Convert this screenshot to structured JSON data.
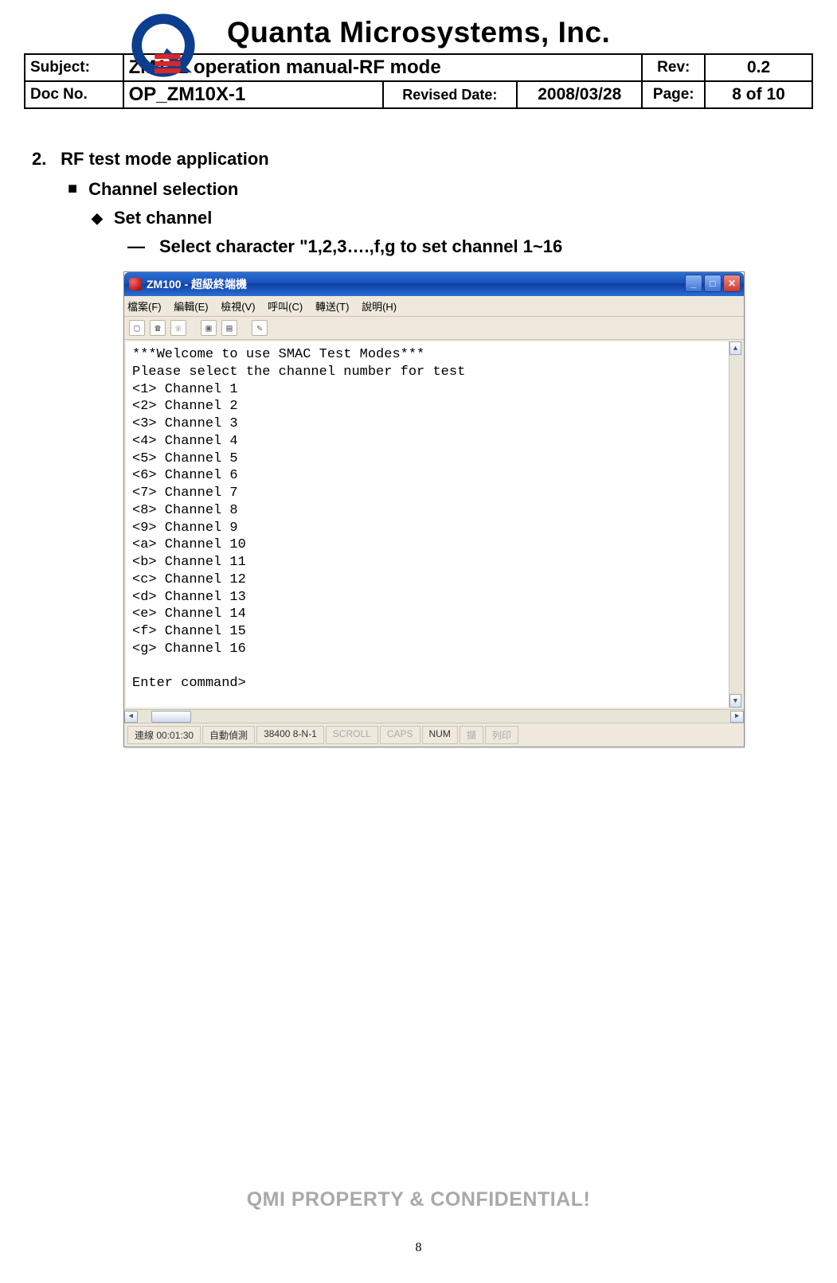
{
  "header": {
    "company": "Quanta Microsystems, Inc.",
    "row1": {
      "subject_label": "Subject:",
      "subject_value": "ZM101 operation manual-RF mode",
      "rev_label": "Rev:",
      "rev_value": "0.2"
    },
    "row2": {
      "docno_label": "Doc No.",
      "docno_value": "OP_ZM10X-1",
      "revdate_label": "Revised Date:",
      "revdate_value": "2008/03/28",
      "page_label": "Page:",
      "page_value": "8 of 10"
    }
  },
  "section": {
    "num": "2.",
    "title": "RF test mode application",
    "sub1": "Channel selection",
    "sub2": "Set channel",
    "sub3": "Select character \"1,2,3….,f,g to set channel 1~16"
  },
  "screenshot": {
    "title": "ZM100 - 超級終端機",
    "menu": {
      "m1": "檔案(F)",
      "m2": "編輯(E)",
      "m3": "檢視(V)",
      "m4": "呼叫(C)",
      "m5": "轉送(T)",
      "m6": "說明(H)"
    },
    "terminal": {
      "l0": "***Welcome to use SMAC Test Modes***",
      "l1": "",
      "l2": "Please select the channel number for test",
      "l3": "",
      "c": [
        "<1> Channel 1",
        "<2> Channel 2",
        "<3> Channel 3",
        "<4> Channel 4",
        "<5> Channel 5",
        "<6> Channel 6",
        "<7> Channel 7",
        "<8> Channel 8",
        "<9> Channel 9",
        "<a> Channel 10",
        "<b> Channel 11",
        "<c> Channel 12",
        "<d> Channel 13",
        "<e> Channel 14",
        "<f> Channel 15",
        "<g> Channel 16"
      ],
      "prompt": "Enter command>"
    },
    "status": {
      "s1": "連線 00:01:30",
      "s2": "自動偵測",
      "s3": "38400 8-N-1",
      "s4": "SCROLL",
      "s5": "CAPS",
      "s6": "NUM",
      "s7": "擷",
      "s8": "列印"
    }
  },
  "footer": {
    "conf": "QMI PROPERTY & CONFIDENTIAL!",
    "pgnum": "8"
  }
}
